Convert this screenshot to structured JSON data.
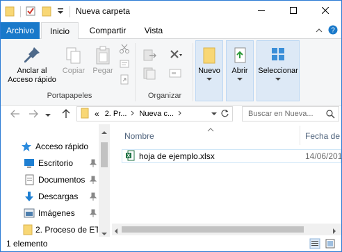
{
  "window": {
    "title": "Nueva carpeta"
  },
  "titlebar": {
    "minimize": "minimize-icon",
    "maximize": "maximize-icon",
    "close": "close-icon"
  },
  "tabs": [
    {
      "label": "Archivo"
    },
    {
      "label": "Inicio"
    },
    {
      "label": "Compartir"
    },
    {
      "label": "Vista"
    }
  ],
  "ribbon": {
    "groups": {
      "portapapeles": "Portapapeles",
      "organizar": "Organizar"
    },
    "anclar": {
      "line1": "Anclar al",
      "line2": "Acceso rápido"
    },
    "copiar": "Copiar",
    "pegar": "Pegar",
    "nuevo": "Nuevo",
    "abrir": "Abrir",
    "seleccionar": "Seleccionar"
  },
  "address": {
    "chevrons": "«",
    "crumb1": "2. Pr...",
    "crumb2": "Nueva c...",
    "search_placeholder": "Buscar en Nueva..."
  },
  "navpane": {
    "items": [
      {
        "label": "Acceso rápido",
        "icon": "star-icon"
      },
      {
        "label": "Escritorio",
        "icon": "desktop-icon"
      },
      {
        "label": "Documentos",
        "icon": "documents-icon"
      },
      {
        "label": "Descargas",
        "icon": "download-icon"
      },
      {
        "label": "Imágenes",
        "icon": "pictures-icon"
      },
      {
        "label": "2. Proceso de ET",
        "icon": "folder-icon"
      }
    ]
  },
  "filelist": {
    "columns": {
      "name": "Nombre",
      "date": "Fecha de m"
    },
    "files": [
      {
        "name": "hoja de ejemplo.xlsx",
        "date": "14/06/201",
        "icon": "excel-file-icon"
      }
    ]
  },
  "status": {
    "count": "1 elemento"
  },
  "colors": {
    "accent": "#1979ca",
    "folder": "#f8d775",
    "ribbon_bg": "#f5f6f7"
  }
}
